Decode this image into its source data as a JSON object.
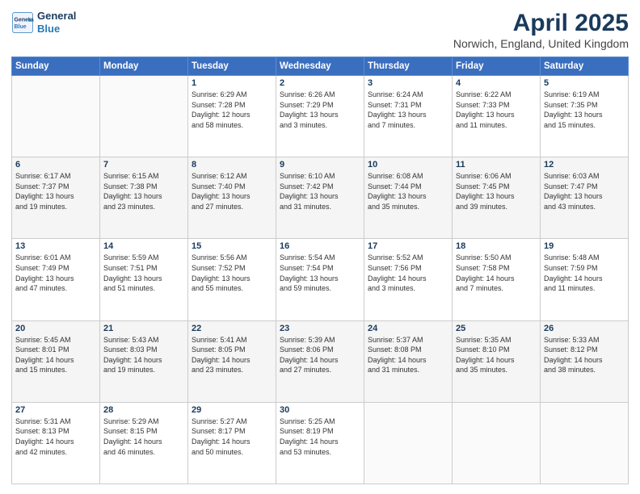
{
  "logo": {
    "line1": "General",
    "line2": "Blue"
  },
  "title": "April 2025",
  "subtitle": "Norwich, England, United Kingdom",
  "days_of_week": [
    "Sunday",
    "Monday",
    "Tuesday",
    "Wednesday",
    "Thursday",
    "Friday",
    "Saturday"
  ],
  "weeks": [
    [
      {
        "day": "",
        "info": ""
      },
      {
        "day": "",
        "info": ""
      },
      {
        "day": "1",
        "info": "Sunrise: 6:29 AM\nSunset: 7:28 PM\nDaylight: 12 hours\nand 58 minutes."
      },
      {
        "day": "2",
        "info": "Sunrise: 6:26 AM\nSunset: 7:29 PM\nDaylight: 13 hours\nand 3 minutes."
      },
      {
        "day": "3",
        "info": "Sunrise: 6:24 AM\nSunset: 7:31 PM\nDaylight: 13 hours\nand 7 minutes."
      },
      {
        "day": "4",
        "info": "Sunrise: 6:22 AM\nSunset: 7:33 PM\nDaylight: 13 hours\nand 11 minutes."
      },
      {
        "day": "5",
        "info": "Sunrise: 6:19 AM\nSunset: 7:35 PM\nDaylight: 13 hours\nand 15 minutes."
      }
    ],
    [
      {
        "day": "6",
        "info": "Sunrise: 6:17 AM\nSunset: 7:37 PM\nDaylight: 13 hours\nand 19 minutes."
      },
      {
        "day": "7",
        "info": "Sunrise: 6:15 AM\nSunset: 7:38 PM\nDaylight: 13 hours\nand 23 minutes."
      },
      {
        "day": "8",
        "info": "Sunrise: 6:12 AM\nSunset: 7:40 PM\nDaylight: 13 hours\nand 27 minutes."
      },
      {
        "day": "9",
        "info": "Sunrise: 6:10 AM\nSunset: 7:42 PM\nDaylight: 13 hours\nand 31 minutes."
      },
      {
        "day": "10",
        "info": "Sunrise: 6:08 AM\nSunset: 7:44 PM\nDaylight: 13 hours\nand 35 minutes."
      },
      {
        "day": "11",
        "info": "Sunrise: 6:06 AM\nSunset: 7:45 PM\nDaylight: 13 hours\nand 39 minutes."
      },
      {
        "day": "12",
        "info": "Sunrise: 6:03 AM\nSunset: 7:47 PM\nDaylight: 13 hours\nand 43 minutes."
      }
    ],
    [
      {
        "day": "13",
        "info": "Sunrise: 6:01 AM\nSunset: 7:49 PM\nDaylight: 13 hours\nand 47 minutes."
      },
      {
        "day": "14",
        "info": "Sunrise: 5:59 AM\nSunset: 7:51 PM\nDaylight: 13 hours\nand 51 minutes."
      },
      {
        "day": "15",
        "info": "Sunrise: 5:56 AM\nSunset: 7:52 PM\nDaylight: 13 hours\nand 55 minutes."
      },
      {
        "day": "16",
        "info": "Sunrise: 5:54 AM\nSunset: 7:54 PM\nDaylight: 13 hours\nand 59 minutes."
      },
      {
        "day": "17",
        "info": "Sunrise: 5:52 AM\nSunset: 7:56 PM\nDaylight: 14 hours\nand 3 minutes."
      },
      {
        "day": "18",
        "info": "Sunrise: 5:50 AM\nSunset: 7:58 PM\nDaylight: 14 hours\nand 7 minutes."
      },
      {
        "day": "19",
        "info": "Sunrise: 5:48 AM\nSunset: 7:59 PM\nDaylight: 14 hours\nand 11 minutes."
      }
    ],
    [
      {
        "day": "20",
        "info": "Sunrise: 5:45 AM\nSunset: 8:01 PM\nDaylight: 14 hours\nand 15 minutes."
      },
      {
        "day": "21",
        "info": "Sunrise: 5:43 AM\nSunset: 8:03 PM\nDaylight: 14 hours\nand 19 minutes."
      },
      {
        "day": "22",
        "info": "Sunrise: 5:41 AM\nSunset: 8:05 PM\nDaylight: 14 hours\nand 23 minutes."
      },
      {
        "day": "23",
        "info": "Sunrise: 5:39 AM\nSunset: 8:06 PM\nDaylight: 14 hours\nand 27 minutes."
      },
      {
        "day": "24",
        "info": "Sunrise: 5:37 AM\nSunset: 8:08 PM\nDaylight: 14 hours\nand 31 minutes."
      },
      {
        "day": "25",
        "info": "Sunrise: 5:35 AM\nSunset: 8:10 PM\nDaylight: 14 hours\nand 35 minutes."
      },
      {
        "day": "26",
        "info": "Sunrise: 5:33 AM\nSunset: 8:12 PM\nDaylight: 14 hours\nand 38 minutes."
      }
    ],
    [
      {
        "day": "27",
        "info": "Sunrise: 5:31 AM\nSunset: 8:13 PM\nDaylight: 14 hours\nand 42 minutes."
      },
      {
        "day": "28",
        "info": "Sunrise: 5:29 AM\nSunset: 8:15 PM\nDaylight: 14 hours\nand 46 minutes."
      },
      {
        "day": "29",
        "info": "Sunrise: 5:27 AM\nSunset: 8:17 PM\nDaylight: 14 hours\nand 50 minutes."
      },
      {
        "day": "30",
        "info": "Sunrise: 5:25 AM\nSunset: 8:19 PM\nDaylight: 14 hours\nand 53 minutes."
      },
      {
        "day": "",
        "info": ""
      },
      {
        "day": "",
        "info": ""
      },
      {
        "day": "",
        "info": ""
      }
    ]
  ]
}
